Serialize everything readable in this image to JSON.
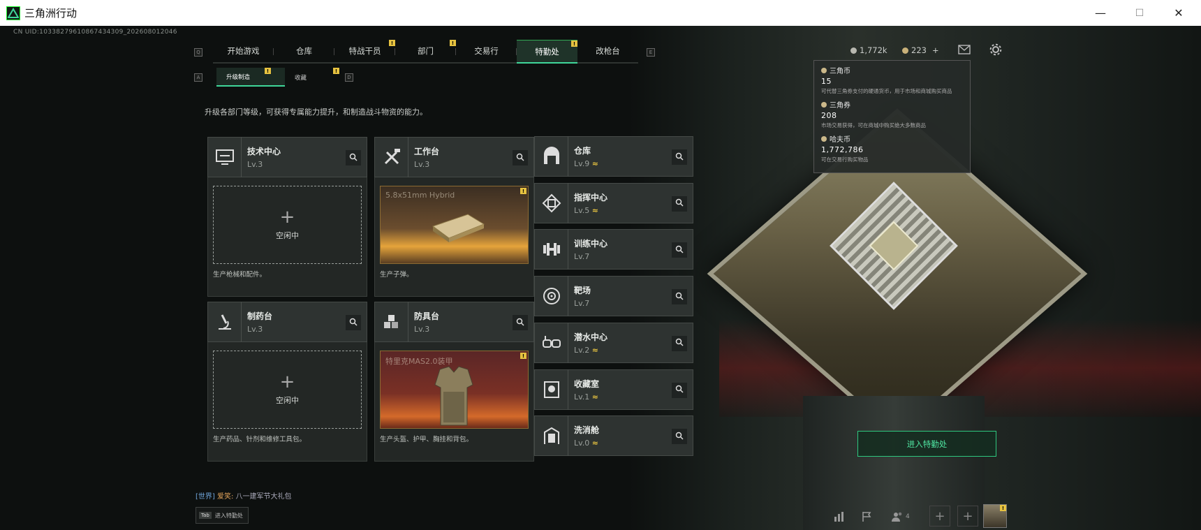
{
  "window": {
    "title": "三角洲行动",
    "minimize": "—",
    "maximize": "☐",
    "close": "✕"
  },
  "uid": "CN UID:1033827961086743430​9_202608012046",
  "nav": {
    "left_key": "Q",
    "right_key": "E",
    "tabs": [
      {
        "label": "开始游戏",
        "badge": ""
      },
      {
        "label": "仓库",
        "badge": ""
      },
      {
        "label": "特战干员",
        "badge": "!"
      },
      {
        "label": "部门",
        "badge": "!"
      },
      {
        "label": "交易行",
        "badge": ""
      },
      {
        "label": "特勤处",
        "badge": "!",
        "active": true
      },
      {
        "label": "改枪台",
        "badge": ""
      }
    ]
  },
  "subnav": {
    "left_key": "A",
    "right_key": "D",
    "tabs": [
      {
        "label": "升级制造",
        "badge": "!",
        "active": true
      },
      {
        "label": "收藏",
        "badge": "!"
      }
    ]
  },
  "description": "升级各部门等级，可获得专属能力提升，和制造战斗物资的能力。",
  "workstations": [
    {
      "name": "技术中心",
      "level": "Lv.3",
      "state": "空闲中",
      "footer": "生产枪械和配件。"
    },
    {
      "name": "工作台",
      "level": "Lv.3",
      "item": "5.8x51mm Hybrid",
      "badge": "!",
      "footer": "生产子弹。"
    },
    {
      "name": "制药台",
      "level": "Lv.3",
      "state": "空闲中",
      "footer": "生产药品、针剂和维修工具包。"
    },
    {
      "name": "防具台",
      "level": "Lv.3",
      "item": "特里克MAS2.0装甲",
      "badge": "!",
      "footer": "生产头盔、护甲、胸挂和背包。"
    }
  ],
  "facilities": [
    {
      "name": "仓库",
      "level": "Lv.9",
      "upgradable": true
    },
    {
      "name": "指挥中心",
      "level": "Lv.5",
      "upgradable": true
    },
    {
      "name": "训练中心",
      "level": "Lv.7",
      "upgradable": false
    },
    {
      "name": "靶场",
      "level": "Lv.7",
      "upgradable": false
    },
    {
      "name": "潜水中心",
      "level": "Lv.2",
      "upgradable": true
    },
    {
      "name": "收藏室",
      "level": "Lv.1",
      "upgradable": true
    },
    {
      "name": "洗消舱",
      "level": "Lv.0",
      "upgradable": true
    }
  ],
  "upgrade_glyph": "≈",
  "currency": {
    "hafu": "1,772k",
    "triangle_coupon": "223",
    "add": "+"
  },
  "tooltip": {
    "items": [
      {
        "name": "三角币",
        "value": "15",
        "desc": "可代替三角券支付的硬通货币，用于市场和商城购买商品"
      },
      {
        "name": "三角券",
        "value": "208",
        "desc": "市场交易获得，可在商城中购买绝大多数商品"
      },
      {
        "name": "哈夫币",
        "value": "1,772,786",
        "desc": "可在交易行购买物品"
      }
    ]
  },
  "enter_button": "进入特勤处",
  "chat": {
    "channel": "[世界]",
    "user": "爱笑:",
    "message": "八一建军节大礼包"
  },
  "tab_hint": {
    "key": "Tab",
    "label": "进入特勤处"
  },
  "bottom": {
    "friends_count": "4",
    "avatar_badge": "!"
  },
  "colors": {
    "accent": "#3fd79a",
    "badge": "#e6c240",
    "panel": "#2e3331"
  }
}
